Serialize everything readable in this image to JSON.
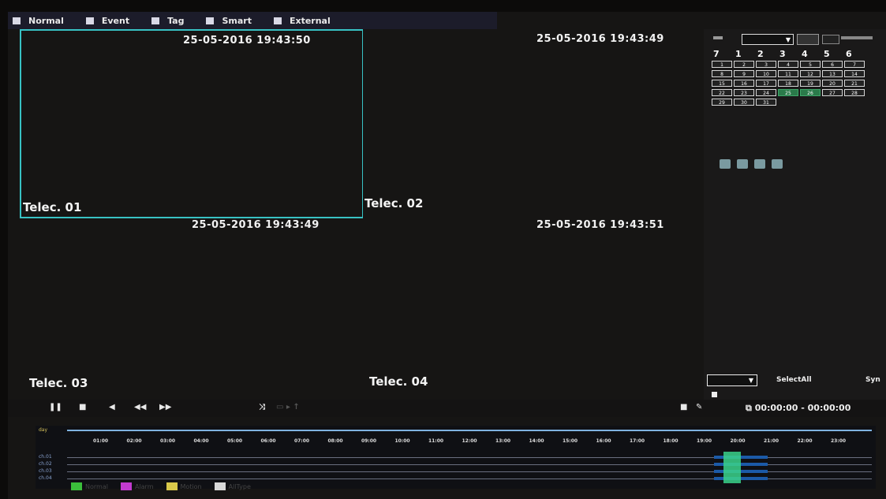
{
  "tabs": [
    {
      "label": "Normal",
      "icon": "normal-icon"
    },
    {
      "label": "Event",
      "icon": "event-icon"
    },
    {
      "label": "Tag",
      "icon": "tag-icon"
    },
    {
      "label": "Smart",
      "icon": "smart-icon"
    },
    {
      "label": "External",
      "icon": "external-icon"
    }
  ],
  "cameras": [
    {
      "name": "Telec. 01",
      "timestamp": "25-05-2016 19:43:50"
    },
    {
      "name": "Telec. 02",
      "timestamp": "25-05-2016 19:43:49"
    },
    {
      "name": "Telec. 03",
      "timestamp": "25-05-2016 19:43:49"
    },
    {
      "name": "Telec. 04",
      "timestamp": "25-05-2016 19:43:51"
    }
  ],
  "calendar": {
    "week_header": [
      "7",
      "1",
      "2",
      "3",
      "4",
      "5",
      "6"
    ],
    "days": [
      "1",
      "2",
      "3",
      "4",
      "5",
      "6",
      "7",
      "8",
      "9",
      "10",
      "11",
      "12",
      "13",
      "14",
      "15",
      "16",
      "17",
      "18",
      "19",
      "20",
      "21",
      "22",
      "23",
      "24",
      "25",
      "26",
      "27",
      "28",
      "29",
      "30",
      "31"
    ],
    "recorded_days": [
      "25",
      "26"
    ]
  },
  "right_panel": {
    "select_all_label": "SelectAll",
    "syn_label": "Syn"
  },
  "playback": {
    "time_range": "00:00:00 - 00:00:00"
  },
  "timeline": {
    "day_label": "day",
    "hours": [
      "01:00",
      "02:00",
      "03:00",
      "04:00",
      "05:00",
      "06:00",
      "07:00",
      "08:00",
      "09:00",
      "10:00",
      "11:00",
      "12:00",
      "13:00",
      "14:00",
      "15:00",
      "16:00",
      "17:00",
      "18:00",
      "19:00",
      "20:00",
      "21:00",
      "22:00",
      "23:00"
    ],
    "channels": [
      "ch.01",
      "ch.02",
      "ch.03",
      "ch.04"
    ]
  },
  "legend": [
    {
      "label": "Normal",
      "color": "#3bbf3b"
    },
    {
      "label": "Alarm",
      "color": "#c23bd0"
    },
    {
      "label": "Motion",
      "color": "#d8c84a"
    },
    {
      "label": "AllType",
      "color": "#d8d8d8"
    }
  ],
  "colors": {
    "selection_border": "#38c2c4",
    "record_bar": "#1b5aa8",
    "cursor": "#3ad28a"
  }
}
